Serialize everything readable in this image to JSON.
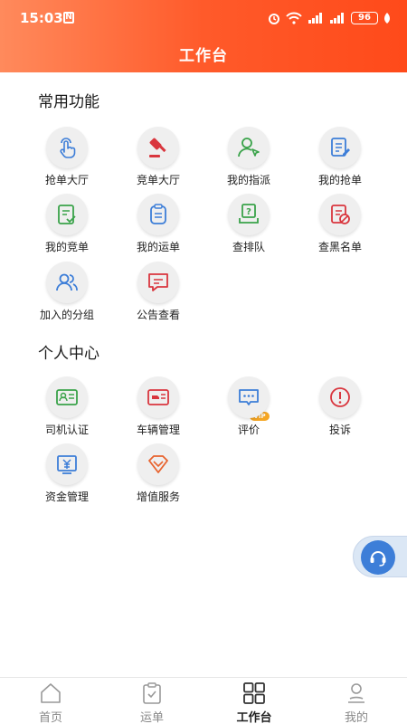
{
  "status": {
    "time": "15:03",
    "battery": "96"
  },
  "header": {
    "title": "工作台"
  },
  "sections": {
    "common": {
      "title": "常用功能",
      "items": [
        {
          "label": "抢单大厅"
        },
        {
          "label": "竞单大厅"
        },
        {
          "label": "我的指派"
        },
        {
          "label": "我的抢单"
        },
        {
          "label": "我的竞单"
        },
        {
          "label": "我的运单"
        },
        {
          "label": "查排队"
        },
        {
          "label": "查黑名单"
        },
        {
          "label": "加入的分组"
        },
        {
          "label": "公告查看"
        }
      ]
    },
    "personal": {
      "title": "个人中心",
      "items": [
        {
          "label": "司机认证"
        },
        {
          "label": "车辆管理"
        },
        {
          "label": "评价"
        },
        {
          "label": "投诉"
        },
        {
          "label": "资金管理"
        },
        {
          "label": "增值服务"
        }
      ]
    }
  },
  "vip_badge": "VIP",
  "tabbar": {
    "tabs": [
      {
        "label": "首页"
      },
      {
        "label": "运单"
      },
      {
        "label": "工作台"
      },
      {
        "label": "我的"
      }
    ]
  },
  "colors": {
    "accent": "#ff5a2a",
    "blue": "#3d7ed8",
    "red": "#d9363e",
    "green": "#3aa34a"
  }
}
